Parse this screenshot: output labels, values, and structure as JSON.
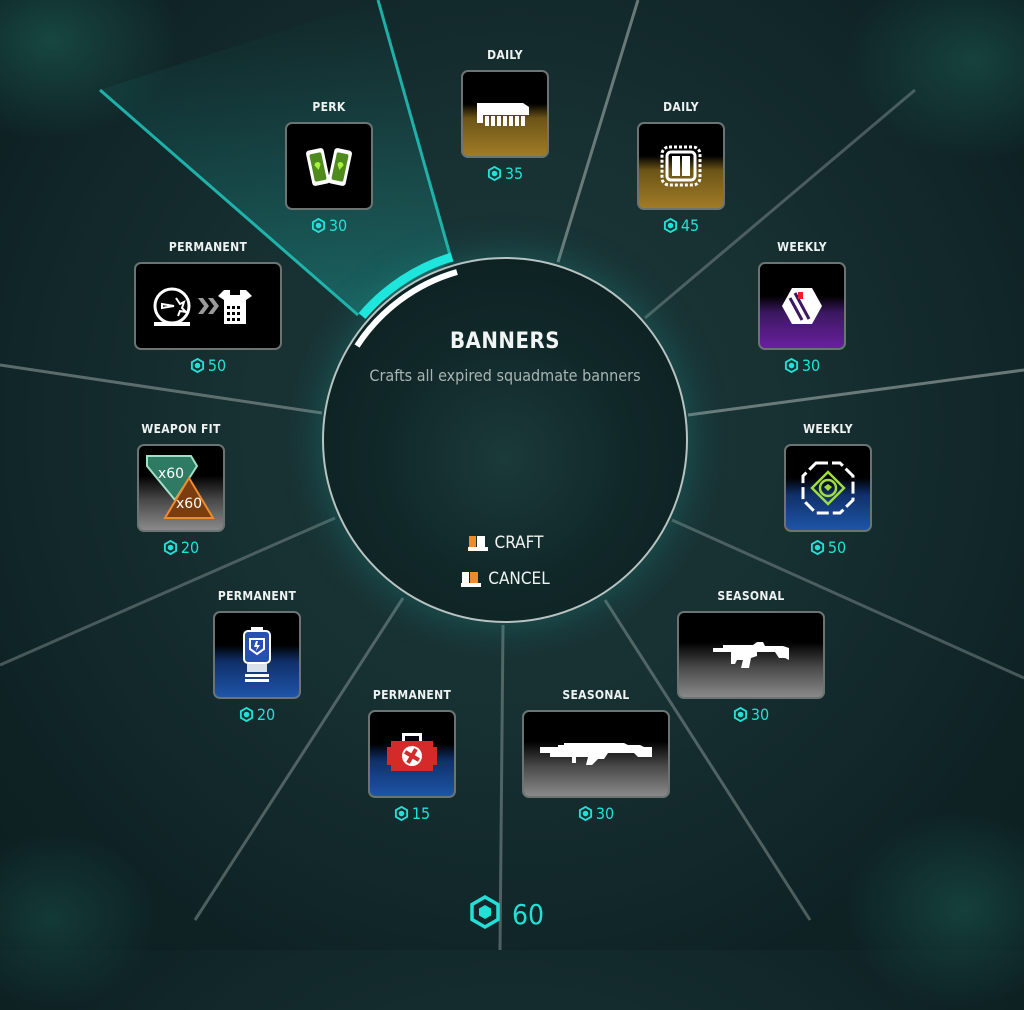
{
  "crafting_wheel": {
    "selected": {
      "title": "BANNERS",
      "description": "Crafts all expired squadmate banners"
    },
    "actions": {
      "craft_label": "CRAFT",
      "cancel_label": "CANCEL"
    },
    "items": [
      {
        "id": "daily-1",
        "category": "DAILY",
        "cost": "35",
        "icon": "magazine-icon",
        "rarity": "gold"
      },
      {
        "id": "daily-2",
        "category": "DAILY",
        "cost": "45",
        "icon": "ammo-chip-icon",
        "rarity": "gold"
      },
      {
        "id": "weekly-1",
        "category": "WEEKLY",
        "cost": "30",
        "icon": "hex-key-icon",
        "rarity": "purple"
      },
      {
        "id": "weekly-2",
        "category": "WEEKLY",
        "cost": "50",
        "icon": "heal-recycle-icon",
        "rarity": "blue"
      },
      {
        "id": "seasonal-1",
        "category": "SEASONAL",
        "cost": "30",
        "icon": "smg-icon",
        "rarity": "gray"
      },
      {
        "id": "seasonal-2",
        "category": "SEASONAL",
        "cost": "30",
        "icon": "sniper-rifle-icon",
        "rarity": "gray"
      },
      {
        "id": "permanent-med",
        "category": "PERMANENT",
        "cost": "15",
        "icon": "medkit-icon",
        "rarity": "blue"
      },
      {
        "id": "permanent-cell",
        "category": "PERMANENT",
        "cost": "20",
        "icon": "shield-cell-icon",
        "rarity": "blue"
      },
      {
        "id": "weapon-fit",
        "category": "WEAPON FIT",
        "cost": "20",
        "icon": "ammo-pack-icon",
        "rarity": "gray",
        "badges": [
          "x60",
          "x60"
        ]
      },
      {
        "id": "permanent-evo",
        "category": "PERMANENT",
        "cost": "50",
        "icon": "armor-evo-icon",
        "rarity": "black"
      },
      {
        "id": "perk",
        "category": "PERK",
        "cost": "30",
        "icon": "syringe-pair-icon",
        "rarity": "black"
      }
    ],
    "currency": {
      "name": "crafting-metals",
      "balance": "60",
      "color": "#23e0d6"
    },
    "accent_color": "#1ee6dc"
  }
}
